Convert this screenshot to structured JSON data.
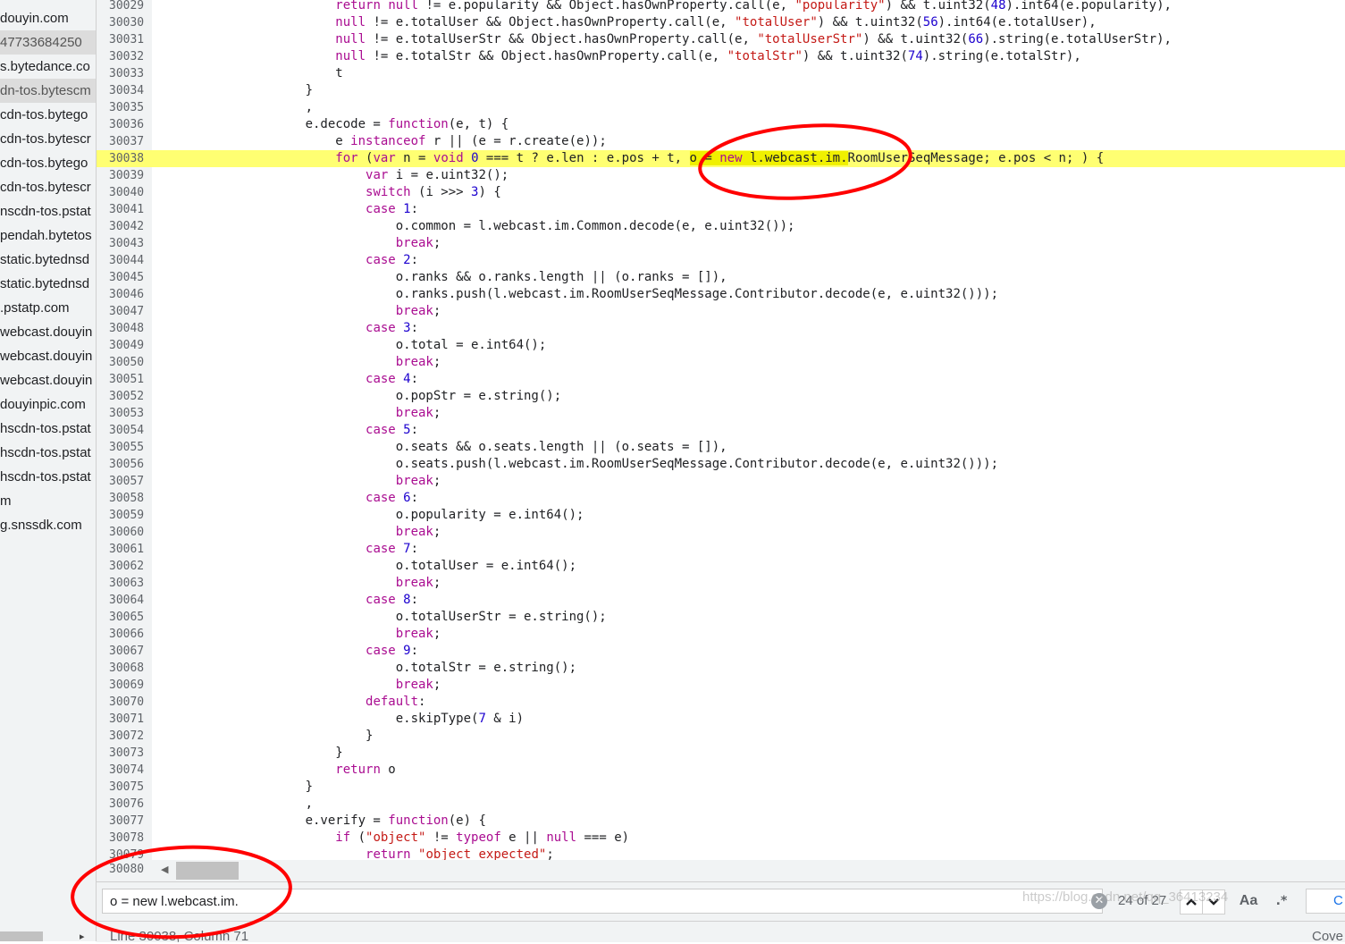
{
  "sidebar": {
    "items": [
      {
        "label": "douyin.com",
        "selected": false
      },
      {
        "label": "47733684250",
        "selected": true
      },
      {
        "label": "s.bytedance.co",
        "selected": false
      },
      {
        "label": "dn-tos.bytescm",
        "selected": true
      },
      {
        "label": "cdn-tos.bytego",
        "selected": false
      },
      {
        "label": "cdn-tos.bytescr",
        "selected": false
      },
      {
        "label": "cdn-tos.bytego",
        "selected": false
      },
      {
        "label": "cdn-tos.bytescr",
        "selected": false
      },
      {
        "label": "nscdn-tos.pstat",
        "selected": false
      },
      {
        "label": "pendah.bytetos",
        "selected": false
      },
      {
        "label": "static.bytednsd",
        "selected": false
      },
      {
        "label": "static.bytednsd",
        "selected": false
      },
      {
        "label": ".pstatp.com",
        "selected": false
      },
      {
        "label": "webcast.douyin",
        "selected": false
      },
      {
        "label": "webcast.douyin",
        "selected": false
      },
      {
        "label": "webcast.douyin",
        "selected": false
      },
      {
        "label": "douyinpic.com",
        "selected": false
      },
      {
        "label": "hscdn-tos.pstat",
        "selected": false
      },
      {
        "label": "hscdn-tos.pstat",
        "selected": false
      },
      {
        "label": "hscdn-tos.pstat",
        "selected": false
      },
      {
        "label": "m",
        "selected": false
      },
      {
        "label": "g.snssdk.com",
        "selected": false
      }
    ]
  },
  "editor": {
    "highlighted_line": "30038",
    "lines": [
      {
        "n": "30029",
        "code": "                        return null != e.popularity && Object.hasOwnProperty.call(e, \"popularity\") && t.uint32(48).int64(e.popularity),"
      },
      {
        "n": "30030",
        "code": "                        null != e.totalUser && Object.hasOwnProperty.call(e, \"totalUser\") && t.uint32(56).int64(e.totalUser),"
      },
      {
        "n": "30031",
        "code": "                        null != e.totalUserStr && Object.hasOwnProperty.call(e, \"totalUserStr\") && t.uint32(66).string(e.totalUserStr),"
      },
      {
        "n": "30032",
        "code": "                        null != e.totalStr && Object.hasOwnProperty.call(e, \"totalStr\") && t.uint32(74).string(e.totalStr),"
      },
      {
        "n": "30033",
        "code": "                        t"
      },
      {
        "n": "30034",
        "code": "                    }"
      },
      {
        "n": "30035",
        "code": "                    ,"
      },
      {
        "n": "30036",
        "code": "                    e.decode = function(e, t) {"
      },
      {
        "n": "30037",
        "code": "                        e instanceof r || (e = r.create(e));"
      },
      {
        "n": "30038",
        "code": "                        for (var n = void 0 === t ? e.len : e.pos + t, o = new l.webcast.im.RoomUserSeqMessage; e.pos < n; ) {"
      },
      {
        "n": "30039",
        "code": "                            var i = e.uint32();"
      },
      {
        "n": "30040",
        "code": "                            switch (i >>> 3) {"
      },
      {
        "n": "30041",
        "code": "                            case 1:"
      },
      {
        "n": "30042",
        "code": "                                o.common = l.webcast.im.Common.decode(e, e.uint32());"
      },
      {
        "n": "30043",
        "code": "                                break;"
      },
      {
        "n": "30044",
        "code": "                            case 2:"
      },
      {
        "n": "30045",
        "code": "                                o.ranks && o.ranks.length || (o.ranks = []),"
      },
      {
        "n": "30046",
        "code": "                                o.ranks.push(l.webcast.im.RoomUserSeqMessage.Contributor.decode(e, e.uint32()));"
      },
      {
        "n": "30047",
        "code": "                                break;"
      },
      {
        "n": "30048",
        "code": "                            case 3:"
      },
      {
        "n": "30049",
        "code": "                                o.total = e.int64();"
      },
      {
        "n": "30050",
        "code": "                                break;"
      },
      {
        "n": "30051",
        "code": "                            case 4:"
      },
      {
        "n": "30052",
        "code": "                                o.popStr = e.string();"
      },
      {
        "n": "30053",
        "code": "                                break;"
      },
      {
        "n": "30054",
        "code": "                            case 5:"
      },
      {
        "n": "30055",
        "code": "                                o.seats && o.seats.length || (o.seats = []),"
      },
      {
        "n": "30056",
        "code": "                                o.seats.push(l.webcast.im.RoomUserSeqMessage.Contributor.decode(e, e.uint32()));"
      },
      {
        "n": "30057",
        "code": "                                break;"
      },
      {
        "n": "30058",
        "code": "                            case 6:"
      },
      {
        "n": "30059",
        "code": "                                o.popularity = e.int64();"
      },
      {
        "n": "30060",
        "code": "                                break;"
      },
      {
        "n": "30061",
        "code": "                            case 7:"
      },
      {
        "n": "30062",
        "code": "                                o.totalUser = e.int64();"
      },
      {
        "n": "30063",
        "code": "                                break;"
      },
      {
        "n": "30064",
        "code": "                            case 8:"
      },
      {
        "n": "30065",
        "code": "                                o.totalUserStr = e.string();"
      },
      {
        "n": "30066",
        "code": "                                break;"
      },
      {
        "n": "30067",
        "code": "                            case 9:"
      },
      {
        "n": "30068",
        "code": "                                o.totalStr = e.string();"
      },
      {
        "n": "30069",
        "code": "                                break;"
      },
      {
        "n": "30070",
        "code": "                            default:"
      },
      {
        "n": "30071",
        "code": "                                e.skipType(7 & i)"
      },
      {
        "n": "30072",
        "code": "                            }"
      },
      {
        "n": "30073",
        "code": "                        }"
      },
      {
        "n": "30074",
        "code": "                        return o"
      },
      {
        "n": "30075",
        "code": "                    }"
      },
      {
        "n": "30076",
        "code": "                    ,"
      },
      {
        "n": "30077",
        "code": "                    e.verify = function(e) {"
      },
      {
        "n": "30078",
        "code": "                        if (\"object\" != typeof e || null === e)"
      },
      {
        "n": "30079",
        "code": "                            return \"object expected\";"
      }
    ],
    "last_line_number": "30080"
  },
  "search": {
    "value": "o = new l.webcast.im.",
    "clear_icon": "✕",
    "match_count": "24 of 27",
    "prev_icon": "chevron-up-icon",
    "next_icon": "chevron-down-icon",
    "prev_glyph": "⌃",
    "next_glyph": "⌄",
    "case_label": "Aa",
    "regex_label": ".*",
    "cancel_label": "C"
  },
  "status": {
    "cursor_position": "Line 30038, Column 71",
    "coverage_label": "Cove"
  },
  "watermark": "https://blog.csdn.net/qq_36413234",
  "colors": {
    "highlight": "#ffff72",
    "annotation": "#ff0000",
    "keyword": "#aa0d91",
    "string": "#c41a16",
    "number": "#1c00cf"
  }
}
